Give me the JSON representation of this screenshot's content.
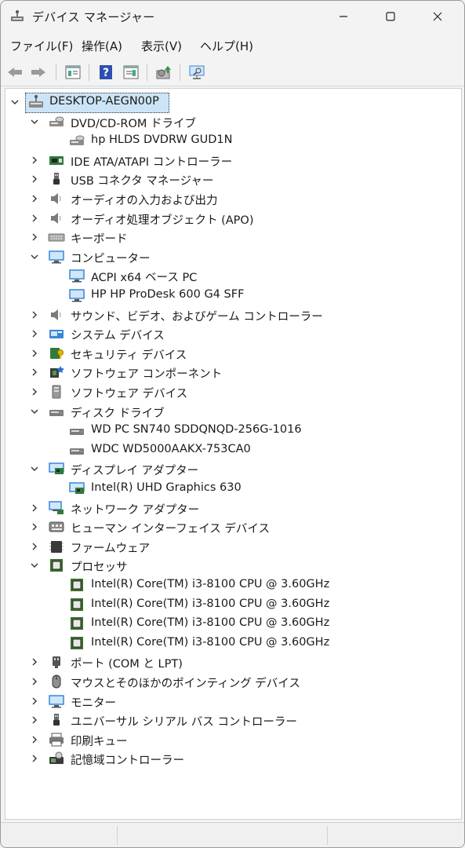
{
  "window": {
    "title": "デバイス マネージャー",
    "icon": "device-manager-icon",
    "controls": [
      "minimize-icon",
      "maximize-icon",
      "close-icon"
    ]
  },
  "menu": [
    "ファイル(F)",
    "操作(A)",
    "表示(V)",
    "ヘルプ(H)"
  ],
  "toolbar": [
    "back-arrow-icon",
    "forward-arrow-icon",
    "properties-icon",
    "help-icon",
    "view-icon",
    "update-driver-icon",
    "scan-hardware-icon"
  ],
  "tree": {
    "root": "DESKTOP-AEGN00P",
    "categories": [
      {
        "label": "DVD/CD-ROM ドライブ",
        "icon": "dvd-drive-icon",
        "expanded": true,
        "children": [
          {
            "label": "hp HLDS DVDRW  GUD1N",
            "icon": "dvd-drive-icon"
          }
        ]
      },
      {
        "label": "IDE ATA/ATAPI コントローラー",
        "icon": "ide-controller-icon",
        "expanded": false
      },
      {
        "label": "USB コネクタ マネージャー",
        "icon": "usb-icon",
        "expanded": false
      },
      {
        "label": "オーディオの入力および出力",
        "icon": "speaker-icon",
        "expanded": false
      },
      {
        "label": "オーディオ処理オブジェクト (APO)",
        "icon": "speaker-icon",
        "expanded": false
      },
      {
        "label": "キーボード",
        "icon": "keyboard-icon",
        "expanded": false
      },
      {
        "label": "コンピューター",
        "icon": "monitor-icon",
        "expanded": true,
        "children": [
          {
            "label": "ACPI x64 ベース PC",
            "icon": "monitor-icon"
          },
          {
            "label": "HP HP ProDesk 600 G4 SFF",
            "icon": "monitor-icon"
          }
        ]
      },
      {
        "label": "サウンド、ビデオ、およびゲーム コントローラー",
        "icon": "speaker-icon",
        "expanded": false
      },
      {
        "label": "システム デバイス",
        "icon": "system-device-icon",
        "expanded": false
      },
      {
        "label": "セキュリティ デバイス",
        "icon": "security-device-icon",
        "expanded": false
      },
      {
        "label": "ソフトウェア コンポーネント",
        "icon": "software-component-icon",
        "expanded": false
      },
      {
        "label": "ソフトウェア デバイス",
        "icon": "software-device-icon",
        "expanded": false
      },
      {
        "label": "ディスク ドライブ",
        "icon": "disk-drive-icon",
        "expanded": true,
        "children": [
          {
            "label": "WD PC SN740 SDDQNQD-256G-1016",
            "icon": "disk-drive-icon"
          },
          {
            "label": "WDC WD5000AAKX-753CA0",
            "icon": "disk-drive-icon"
          }
        ]
      },
      {
        "label": "ディスプレイ アダプター",
        "icon": "display-adapter-icon",
        "expanded": true,
        "children": [
          {
            "label": "Intel(R) UHD Graphics 630",
            "icon": "display-adapter-icon"
          }
        ]
      },
      {
        "label": "ネットワーク アダプター",
        "icon": "network-adapter-icon",
        "expanded": false
      },
      {
        "label": "ヒューマン インターフェイス デバイス",
        "icon": "hid-icon",
        "expanded": false
      },
      {
        "label": "ファームウェア",
        "icon": "firmware-icon",
        "expanded": false
      },
      {
        "label": "プロセッサ",
        "icon": "processor-icon",
        "expanded": true,
        "children": [
          {
            "label": "Intel(R) Core(TM) i3-8100 CPU @ 3.60GHz",
            "icon": "processor-icon"
          },
          {
            "label": "Intel(R) Core(TM) i3-8100 CPU @ 3.60GHz",
            "icon": "processor-icon"
          },
          {
            "label": "Intel(R) Core(TM) i3-8100 CPU @ 3.60GHz",
            "icon": "processor-icon"
          },
          {
            "label": "Intel(R) Core(TM) i3-8100 CPU @ 3.60GHz",
            "icon": "processor-icon"
          }
        ]
      },
      {
        "label": "ポート (COM と LPT)",
        "icon": "port-icon",
        "expanded": false
      },
      {
        "label": "マウスとそのほかのポインティング デバイス",
        "icon": "mouse-icon",
        "expanded": false
      },
      {
        "label": "モニター",
        "icon": "monitor-icon",
        "expanded": false
      },
      {
        "label": "ユニバーサル シリアル バス コントローラー",
        "icon": "usb-icon",
        "expanded": false
      },
      {
        "label": "印刷キュー",
        "icon": "printer-icon",
        "expanded": false
      },
      {
        "label": "記憶域コントローラー",
        "icon": "storage-controller-icon",
        "expanded": false
      }
    ]
  },
  "colors": {
    "selection": "#cce4f7",
    "window_bg": "#f3f3f3",
    "tree_bg": "#ffffff",
    "icon_blue": "#3a86d6",
    "processor_green": "#3c6e2a"
  }
}
